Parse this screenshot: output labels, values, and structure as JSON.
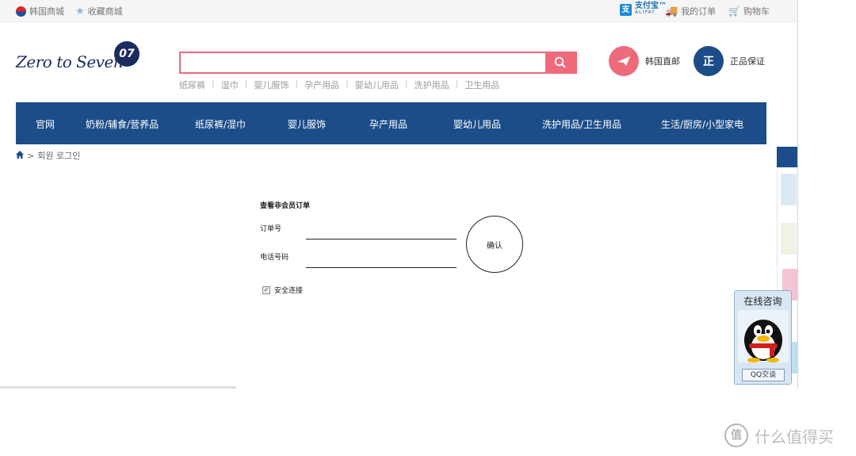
{
  "topbar": {
    "left_links": [
      "韩国商城",
      "收藏商城"
    ],
    "alipay": {
      "cn": "支付宝™",
      "en": "ALIPAY"
    },
    "right_links": [
      "我的订单",
      "购物车"
    ]
  },
  "logo": {
    "text": "Zero to Seven",
    "badge": "07"
  },
  "search": {
    "placeholder": "",
    "keywords": [
      "纸尿裤",
      "湿巾",
      "婴儿服饰",
      "孕产用品",
      "婴幼儿用品",
      "洗护用品",
      "卫生用品"
    ]
  },
  "promises": [
    {
      "icon": "airplane-icon",
      "label": "韩国直邮",
      "color": "#ee6b7c"
    },
    {
      "icon": "genuine-icon",
      "glyph": "正",
      "label": "正品保证",
      "color": "#1c4d88"
    }
  ],
  "nav": {
    "items": [
      "官网",
      "奶粉/辅食/营养品",
      "纸尿裤/湿巾",
      "婴儿服饰",
      "孕产用品",
      "婴幼儿用品",
      "洗护用品/卫生用品",
      "生活/厨房/小型家电"
    ],
    "color": "#1c4d88"
  },
  "breadcrumb": {
    "separator": ">",
    "current": "회원 로그인"
  },
  "form": {
    "title": "查看非会员订单",
    "order_label": "订单号",
    "phone_label": "电话号码",
    "confirm_label": "确认",
    "secure_label": "安全连接",
    "secure_checked": true
  },
  "qq_widget": {
    "title": "在线咨询",
    "button": "QQ交谈"
  },
  "watermark": {
    "text": "什么值得买",
    "icon": "值"
  }
}
